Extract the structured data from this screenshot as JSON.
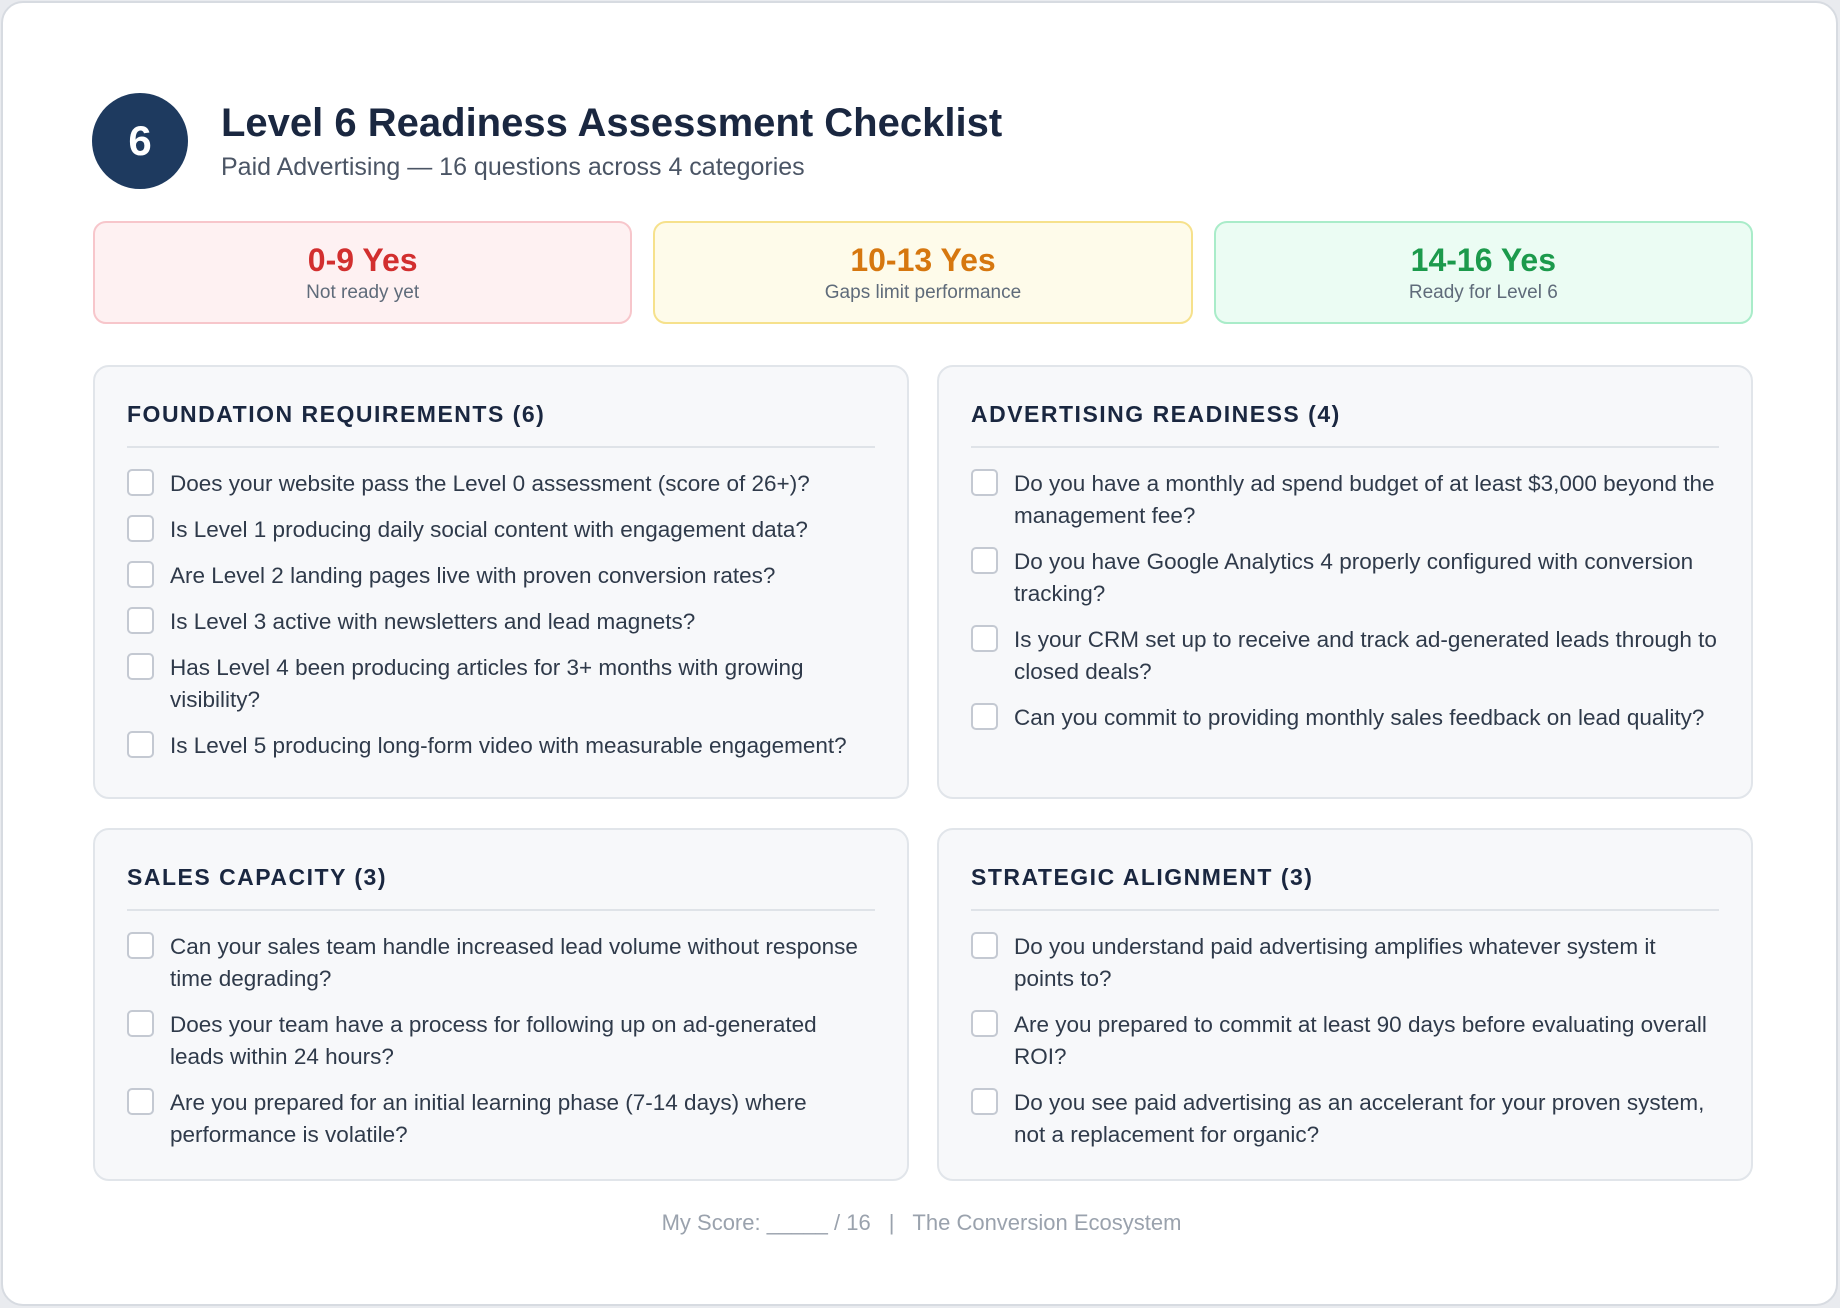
{
  "header": {
    "badge": "6",
    "title": "Level 6 Readiness Assessment Checklist",
    "subtitle": "Paid Advertising — 16 questions across 4 categories"
  },
  "bands": [
    {
      "range": "0-9 Yes",
      "desc": "Not ready yet",
      "color": "#d22f2f"
    },
    {
      "range": "10-13 Yes",
      "desc": "Gaps limit performance",
      "color": "#d6770f"
    },
    {
      "range": "14-16 Yes",
      "desc": "Ready for Level 6",
      "color": "#1c9a4c"
    }
  ],
  "categories": [
    {
      "title": "FOUNDATION REQUIREMENTS (6)",
      "questions": [
        "Does your website pass the Level 0 assessment (score of 26+)?",
        "Is Level 1 producing daily social content with engagement data?",
        "Are Level 2 landing pages live with proven conversion rates?",
        "Is Level 3 active with newsletters and lead magnets?",
        "Has Level 4 been producing articles for 3+ months with growing visibility?",
        "Is Level 5 producing long-form video with measurable engagement?"
      ]
    },
    {
      "title": "ADVERTISING READINESS (4)",
      "questions": [
        "Do you have a monthly ad spend budget of at least $3,000 beyond the management fee?",
        "Do you have Google Analytics 4 properly configured with conversion tracking?",
        "Is your CRM set up to receive and track ad-generated leads through to closed deals?",
        "Can you commit to providing monthly sales feedback on lead quality?"
      ]
    },
    {
      "title": "SALES CAPACITY (3)",
      "questions": [
        "Can your sales team handle increased lead volume without response time degrading?",
        "Does your team have a process for following up on ad-generated leads within 24 hours?",
        "Are you prepared for an initial learning phase (7-14 days) where performance is volatile?"
      ]
    },
    {
      "title": "STRATEGIC ALIGNMENT (3)",
      "questions": [
        "Do you understand paid advertising amplifies whatever system it points to?",
        "Are you prepared to commit at least 90 days before evaluating overall ROI?",
        "Do you see paid advertising as an accelerant for your proven system, not a replacement for organic?"
      ]
    }
  ],
  "footer": {
    "score": "My Score: _____ / 16",
    "separator": "|",
    "brand": "The Conversion Ecosystem"
  }
}
